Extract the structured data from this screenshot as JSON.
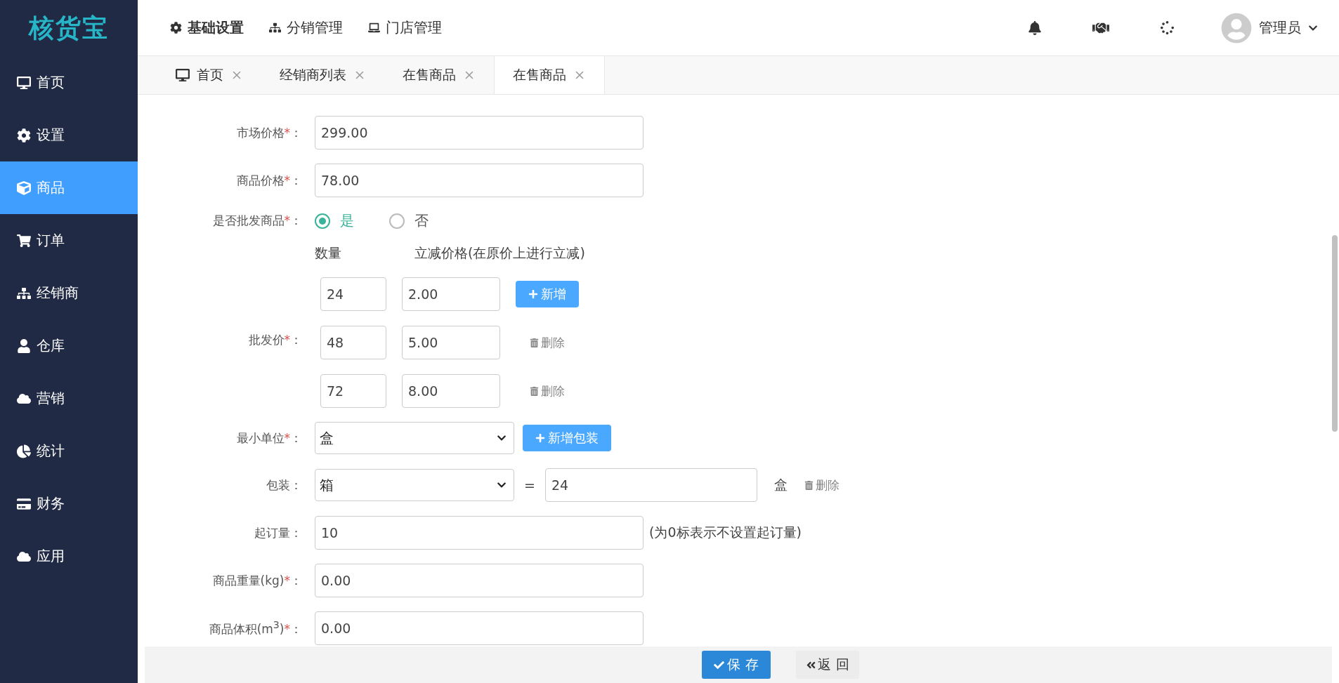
{
  "logo": "核货宝",
  "sidebar": {
    "items": [
      {
        "label": "首页",
        "selected": false
      },
      {
        "label": "设置",
        "selected": false
      },
      {
        "label": "商品",
        "selected": true
      },
      {
        "label": "订单",
        "selected": false
      },
      {
        "label": "经销商",
        "selected": false
      },
      {
        "label": "仓库",
        "selected": false
      },
      {
        "label": "营销",
        "selected": false
      },
      {
        "label": "统计",
        "selected": false
      },
      {
        "label": "财务",
        "selected": false
      },
      {
        "label": "应用",
        "selected": false
      }
    ]
  },
  "top_nav": [
    {
      "label": "基础设置",
      "selected": true
    },
    {
      "label": "分销管理",
      "selected": false
    },
    {
      "label": "门店管理",
      "selected": false
    }
  ],
  "user": {
    "name": "管理员"
  },
  "tabs": [
    {
      "label": "首页",
      "selected": false
    },
    {
      "label": "经销商列表",
      "selected": false
    },
    {
      "label": "在售商品",
      "selected": false
    },
    {
      "label": "在售商品",
      "selected": true
    }
  ],
  "form": {
    "market_price": {
      "label": "市场价格",
      "required_mark": "*",
      "colon": "：",
      "value": "299.00"
    },
    "price": {
      "label": "商品价格",
      "required_mark": "*",
      "colon": "：",
      "value": "78.00"
    },
    "wholesale": {
      "label": "是否批发商品",
      "required_mark": "*",
      "colon": "：",
      "options": [
        {
          "label": "是",
          "selected": true
        },
        {
          "label": "否",
          "selected": false
        }
      ]
    },
    "wholesale_price": {
      "label": "批发价",
      "required_mark": "*",
      "colon": "：",
      "columns": [
        "数量",
        "立减价格(在原价上进行立减)"
      ],
      "rows": [
        {
          "quantity": "24",
          "discount": "2.00",
          "action": "新增",
          "kind": "add"
        },
        {
          "quantity": "48",
          "discount": "5.00",
          "action": "删除",
          "kind": "delete"
        },
        {
          "quantity": "72",
          "discount": "8.00",
          "action": "删除",
          "kind": "delete"
        }
      ]
    },
    "min_unit": {
      "label": "最小单位",
      "required_mark": "*",
      "colon": "：",
      "value": "盒",
      "button": "新增包装"
    },
    "package": {
      "label": "包装",
      "colon": "：",
      "value": "箱",
      "equals": "=",
      "amount": "24",
      "unit": "盒",
      "action": "删除"
    },
    "min_order": {
      "label": "起订量",
      "colon": "：",
      "value": "10",
      "hint": "(为0标表示不设置起订量)"
    },
    "weight": {
      "label": "商品重量(kg)",
      "required_mark": "*",
      "colon": "：",
      "value": "0.00"
    },
    "volume": {
      "label": "商品体积(m$^{3}$)",
      "required_mark": "*",
      "colon": "：",
      "value": "0.00"
    }
  },
  "footer": {
    "save": "保 存",
    "back": "返 回"
  }
}
